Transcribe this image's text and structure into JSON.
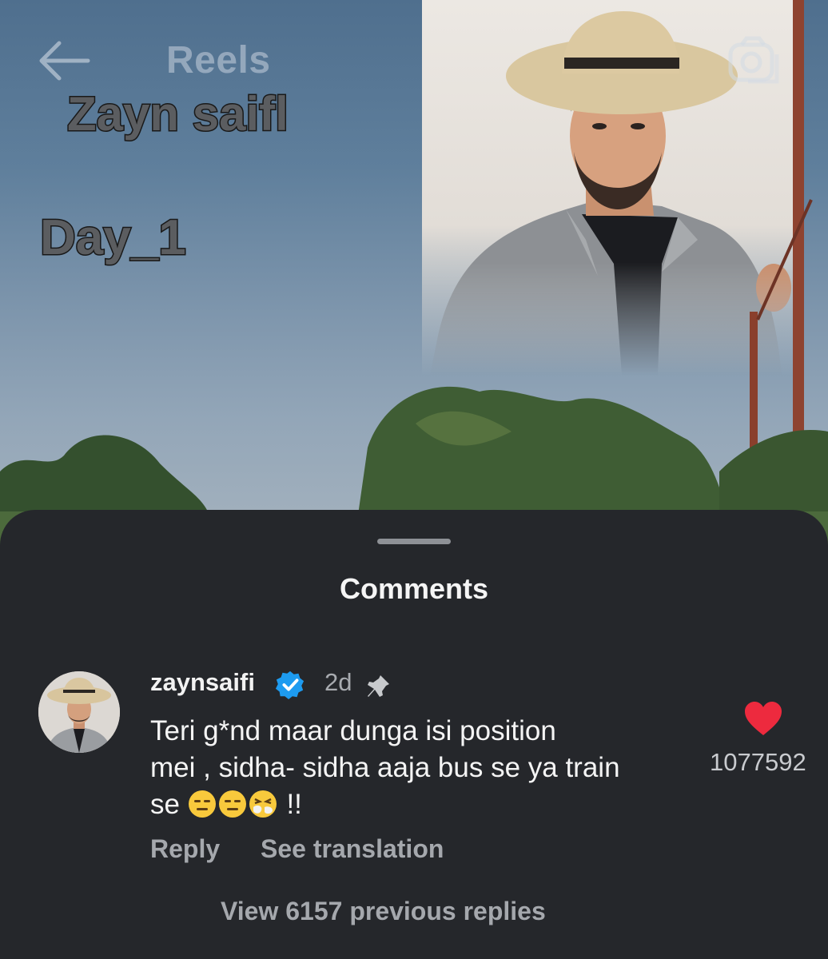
{
  "header": {
    "title": "Reels",
    "back_icon": "arrow-left-icon",
    "camera_icon": "camera-icon"
  },
  "reel": {
    "overlay_name": "Zayn saifl",
    "overlay_day": "Day_1"
  },
  "comments_sheet": {
    "title": "Comments",
    "comment": {
      "username": "zaynsaifi",
      "verified": true,
      "time": "2d",
      "pinned": true,
      "text_line1": "Teri g*nd maar dunga isi position",
      "text_line2": "mei , sidha- sidha aaja bus se ya train",
      "text_line3_prefix": "se",
      "text_line3_suffix": "!!",
      "emojis": [
        "expressionless-face-icon",
        "expressionless-face-icon",
        "sneezing-face-icon"
      ],
      "like_count": "1077592",
      "liked": true,
      "reply_label": "Reply",
      "translate_label": "See translation"
    },
    "view_replies_label": "View 6157 previous replies"
  },
  "colors": {
    "sheet_bg": "#25272b",
    "like_red": "#ed2a3e",
    "verified_blue": "#1d9bf0"
  }
}
